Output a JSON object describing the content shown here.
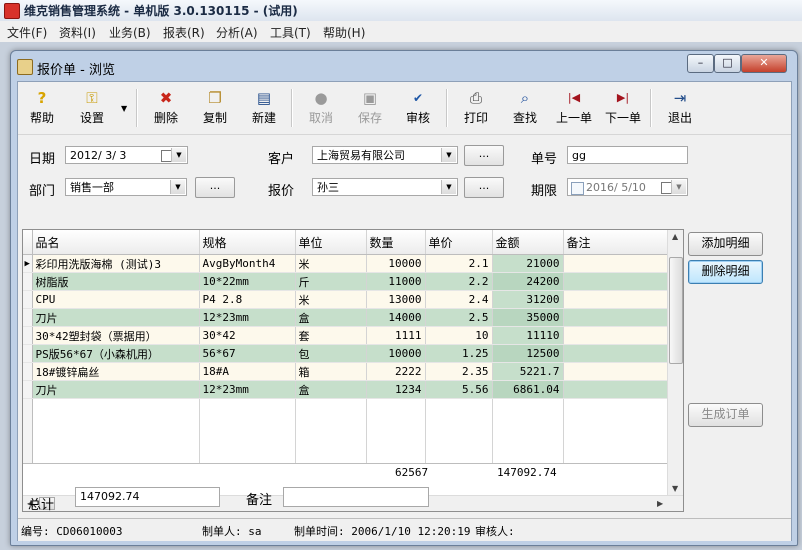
{
  "app": {
    "title": "维克销售管理系统 - 单机版 3.0.130115 - (试用)",
    "menu": [
      "文件(F)",
      "资料(I)",
      "业务(B)",
      "报表(R)",
      "分析(A)",
      "工具(T)",
      "帮助(H)"
    ]
  },
  "window": {
    "title": "报价单 - 浏览",
    "controls": {
      "minimize": "–",
      "maximize": "□",
      "close": "✕"
    }
  },
  "toolbar": {
    "help": "帮助",
    "settings": "设置",
    "delete": "删除",
    "copy": "复制",
    "new": "新建",
    "cancel": "取消",
    "save": "保存",
    "audit": "审核",
    "print": "打印",
    "find": "查找",
    "prev": "上一单",
    "next": "下一单",
    "exit": "退出"
  },
  "form": {
    "date_label": "日期",
    "date_value": "2012/ 3/ 3",
    "customer_label": "客户",
    "customer_value": "上海贸易有限公司",
    "order_no_label": "单号",
    "order_no_value": "gg",
    "dept_label": "部门",
    "dept_value": "销售一部",
    "quoter_label": "报价",
    "quoter_value": "孙三",
    "deadline_label": "期限",
    "deadline_value": "2016/ 5/10",
    "dots": "..."
  },
  "grid": {
    "columns": [
      "品名",
      "规格",
      "单位",
      "数量",
      "单价",
      "金额",
      "备注"
    ],
    "rows": [
      {
        "name": "彩印用洗版海棉 (测试)3",
        "spec": "AvgByMonth4",
        "unit": "米",
        "qty": "10000",
        "price": "2.1",
        "amount": "21000",
        "note": ""
      },
      {
        "name": "树脂版",
        "spec": "10*22mm",
        "unit": "斤",
        "qty": "11000",
        "price": "2.2",
        "amount": "24200",
        "note": ""
      },
      {
        "name": "CPU",
        "spec": "P4 2.8",
        "unit": "米",
        "qty": "13000",
        "price": "2.4",
        "amount": "31200",
        "note": ""
      },
      {
        "name": "刀片",
        "spec": "12*23mm",
        "unit": "盒",
        "qty": "14000",
        "price": "2.5",
        "amount": "35000",
        "note": ""
      },
      {
        "name": "30*42塑封袋（票据用）",
        "spec": "30*42",
        "unit": "套",
        "qty": "1111",
        "price": "10",
        "amount": "11110",
        "note": ""
      },
      {
        "name": "PS版56*67（小森机用）",
        "spec": "56*67",
        "unit": "包",
        "qty": "10000",
        "price": "1.25",
        "amount": "12500",
        "note": ""
      },
      {
        "name": "18#镀锌扁丝",
        "spec": "18#A",
        "unit": "箱",
        "qty": "2222",
        "price": "2.35",
        "amount": "5221.7",
        "note": ""
      },
      {
        "name": "刀片",
        "spec": "12*23mm",
        "unit": "盒",
        "qty": "1234",
        "price": "5.56",
        "amount": "6861.04",
        "note": ""
      }
    ],
    "total_qty": "62567",
    "total_amount": "147092.74"
  },
  "side": {
    "add": "添加明细",
    "remove": "删除明细",
    "make_order": "生成订单"
  },
  "footer": {
    "total_label": "总计",
    "total_value": "147092.74",
    "note_label": "备注",
    "note_value": ""
  },
  "status": {
    "code": "编号: CD06010003",
    "maker": "制单人: sa",
    "time": "制单时间: 2006/1/10 12:20:19",
    "auditor": "审核人:"
  }
}
